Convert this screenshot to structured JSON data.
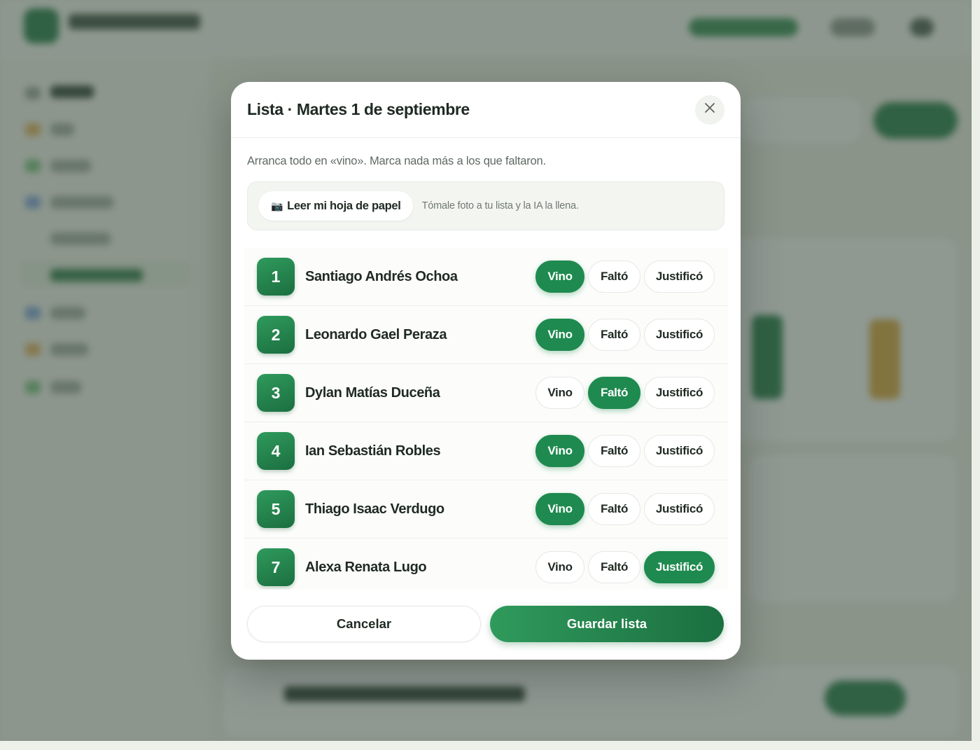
{
  "colors": {
    "accent": "#1f8a4f",
    "accent_dark": "#1b6f40",
    "text": "#1f2a22",
    "muted": "#5f6a62",
    "overlay": "#3e5044"
  },
  "modal": {
    "title": "Lista · Martes 1 de septiembre",
    "subtitle": "Arranca todo en «vino». Marca nada más a los que faltaron.",
    "ocr": {
      "button_icon": "camera-icon",
      "button_label": "Leer mi hoja de papel",
      "hint": "Tómale foto a tu lista y la IA la llena."
    },
    "option_labels": {
      "present": "Vino",
      "absent": "Faltó",
      "excused": "Justificó"
    },
    "students": [
      {
        "number": "1",
        "name": "Santiago Andrés Ochoa",
        "status": "present"
      },
      {
        "number": "2",
        "name": "Leonardo Gael Peraza",
        "status": "present"
      },
      {
        "number": "3",
        "name": "Dylan Matías Duceña",
        "status": "absent"
      },
      {
        "number": "4",
        "name": "Ian Sebastián Robles",
        "status": "present"
      },
      {
        "number": "5",
        "name": "Thiago Isaac Verdugo",
        "status": "present"
      },
      {
        "number": "7",
        "name": "Alexa Renata Lugo",
        "status": "excused"
      }
    ],
    "cancel_label": "Cancelar",
    "save_label": "Guardar lista"
  }
}
